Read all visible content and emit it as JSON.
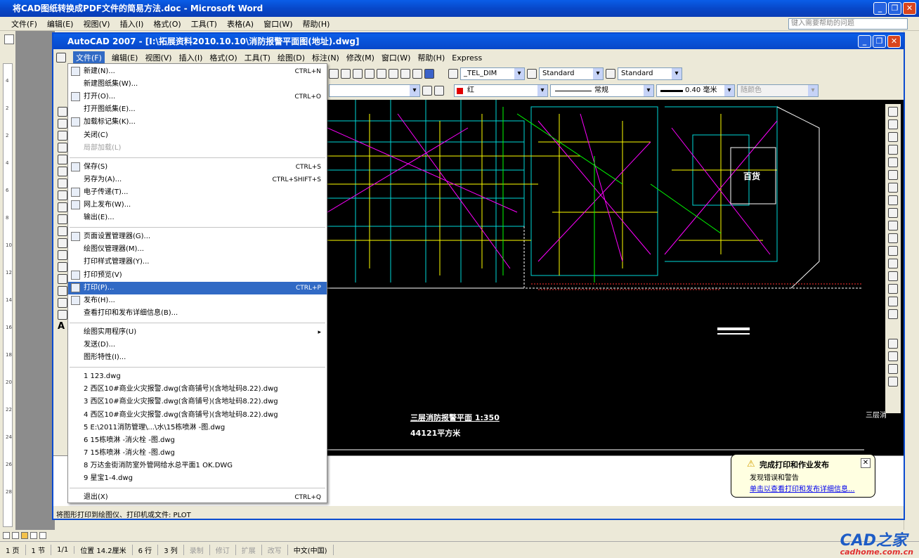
{
  "word": {
    "title": "将CAD图纸转换成PDF文件的简易方法.doc - Microsoft Word",
    "menu": [
      "文件(F)",
      "编辑(E)",
      "视图(V)",
      "插入(I)",
      "格式(O)",
      "工具(T)",
      "表格(A)",
      "窗口(W)",
      "帮助(H)"
    ],
    "help_placeholder": "键入需要帮助的问题",
    "ruler_marks": [
      "4",
      "2",
      "2",
      "4",
      "6",
      "8",
      "10",
      "12",
      "14",
      "16",
      "18",
      "20",
      "22",
      "24",
      "26",
      "28"
    ],
    "status": [
      "1 页",
      "1 节",
      "1/1",
      "位置 14.2厘米",
      "6 行",
      "3 列",
      "录制",
      "修订",
      "扩展",
      "改写",
      "中文(中国)"
    ]
  },
  "cad": {
    "title": "AutoCAD 2007 - [I:\\拓展资料2010.10.10\\消防报警平面图(地址).dwg]",
    "menu": [
      "文件(F)",
      "编辑(E)",
      "视图(V)",
      "插入(I)",
      "格式(O)",
      "工具(T)",
      "绘图(D)",
      "标注(N)",
      "修改(M)",
      "窗口(W)",
      "帮助(H)",
      "Express"
    ],
    "dim_style": "_TEL_DIM",
    "text_style": "Standard",
    "table_style": "Standard",
    "color": "红",
    "linetype": "常规",
    "lineweight": "0.40 毫米",
    "plotstyle": "随颜色",
    "drawing_label": "百货",
    "drawing_title": "三层消防报警平面 1:350",
    "drawing_area": "44121平方米",
    "side_label": "三层消",
    "command": "将图形打印到绘图仪、打印机或文件:  PLOT"
  },
  "file_menu": [
    {
      "label": "新建(N)...",
      "shortcut": "CTRL+N",
      "icon": "new-icon"
    },
    {
      "label": "新建图纸集(W)..."
    },
    {
      "label": "打开(O)...",
      "shortcut": "CTRL+O",
      "icon": "open-icon"
    },
    {
      "label": "打开图纸集(E)..."
    },
    {
      "label": "加载标记集(K)...",
      "icon": "markup-icon"
    },
    {
      "label": "关闭(C)"
    },
    {
      "label": "局部加载(L)",
      "disabled": true
    },
    {
      "sep": true
    },
    {
      "label": "保存(S)",
      "shortcut": "CTRL+S",
      "icon": "save-icon"
    },
    {
      "label": "另存为(A)...",
      "shortcut": "CTRL+SHIFT+S"
    },
    {
      "label": "电子传递(T)...",
      "icon": "etransmit-icon"
    },
    {
      "label": "网上发布(W)...",
      "icon": "publish-web-icon"
    },
    {
      "label": "输出(E)..."
    },
    {
      "sep": true
    },
    {
      "label": "页面设置管理器(G)...",
      "icon": "page-setup-icon"
    },
    {
      "label": "绘图仪管理器(M)..."
    },
    {
      "label": "打印样式管理器(Y)..."
    },
    {
      "label": "打印预览(V)",
      "icon": "preview-icon"
    },
    {
      "label": "打印(P)...",
      "shortcut": "CTRL+P",
      "icon": "print-icon",
      "highlight": true
    },
    {
      "label": "发布(H)...",
      "icon": "publish-icon"
    },
    {
      "label": "查看打印和发布详细信息(B)..."
    },
    {
      "sep": true
    },
    {
      "label": "绘图实用程序(U)",
      "submenu": true
    },
    {
      "label": "发送(D)..."
    },
    {
      "label": "图形特性(I)..."
    },
    {
      "sep": true
    },
    {
      "label": "1 123.dwg"
    },
    {
      "label": "2 西区10#商业火灾报警.dwg(含商铺号)(含地址码8.22).dwg"
    },
    {
      "label": "3 西区10#商业火灾报警.dwg(含商铺号)(含地址码8.22).dwg"
    },
    {
      "label": "4 西区10#商业火灾报警.dwg(含商铺号)(含地址码8.22).dwg"
    },
    {
      "label": "5 E:\\2011消防管理\\...\\水\\15栋喷淋 -图.dwg"
    },
    {
      "label": "6 15栋喷淋 -消火栓 -图.dwg"
    },
    {
      "label": "7 15栋喷淋 -消火栓 -图.dwg"
    },
    {
      "label": "8 万达金街消防室外管网给水总平面1 OK.DWG"
    },
    {
      "label": "9 星宝1-4.dwg"
    },
    {
      "sep": true
    },
    {
      "label": "退出(X)",
      "shortcut": "CTRL+Q"
    }
  ],
  "balloon": {
    "title": "完成打印和作业发布",
    "line1": "发现错误和警告",
    "link": "单击以查看打印和发布详细信息..."
  },
  "logo": {
    "text": "CAD之家",
    "url": "cadhome.com.cn"
  },
  "colors": {
    "xp_blue": "#0a5ee8",
    "menu_highlight": "#316ac5",
    "canvas": "#000000"
  }
}
